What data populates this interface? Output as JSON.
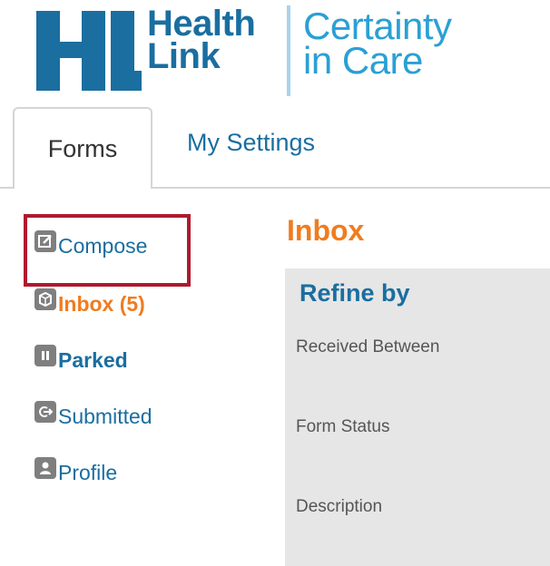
{
  "logo": {
    "brand_line1": "Health",
    "brand_line2": "Link",
    "tagline_line1": "Certainty",
    "tagline_line2": "in Care",
    "brand_color": "#1a6ea0",
    "tagline_color": "#2aa0d4"
  },
  "tabs": [
    {
      "label": "Forms",
      "active": true
    },
    {
      "label": "My Settings",
      "active": false
    }
  ],
  "sidebar": {
    "items": [
      {
        "label": "Compose",
        "icon": "edit-icon",
        "state": "highlighted"
      },
      {
        "label": "Inbox (5)",
        "icon": "inbox-icon",
        "state": "active"
      },
      {
        "label": "Parked",
        "icon": "pause-icon",
        "state": "bold"
      },
      {
        "label": "Submitted",
        "icon": "submit-icon",
        "state": "normal"
      },
      {
        "label": "Profile",
        "icon": "user-icon",
        "state": "normal"
      }
    ]
  },
  "main": {
    "title": "Inbox",
    "refine": {
      "heading": "Refine by",
      "fields": [
        "Received Between",
        "Form Status",
        "Description"
      ]
    }
  },
  "colors": {
    "accent_orange": "#f07c1f",
    "link_blue": "#1a6ea0",
    "highlight_red": "#b0192e",
    "panel_grey": "#e6e6e6"
  }
}
